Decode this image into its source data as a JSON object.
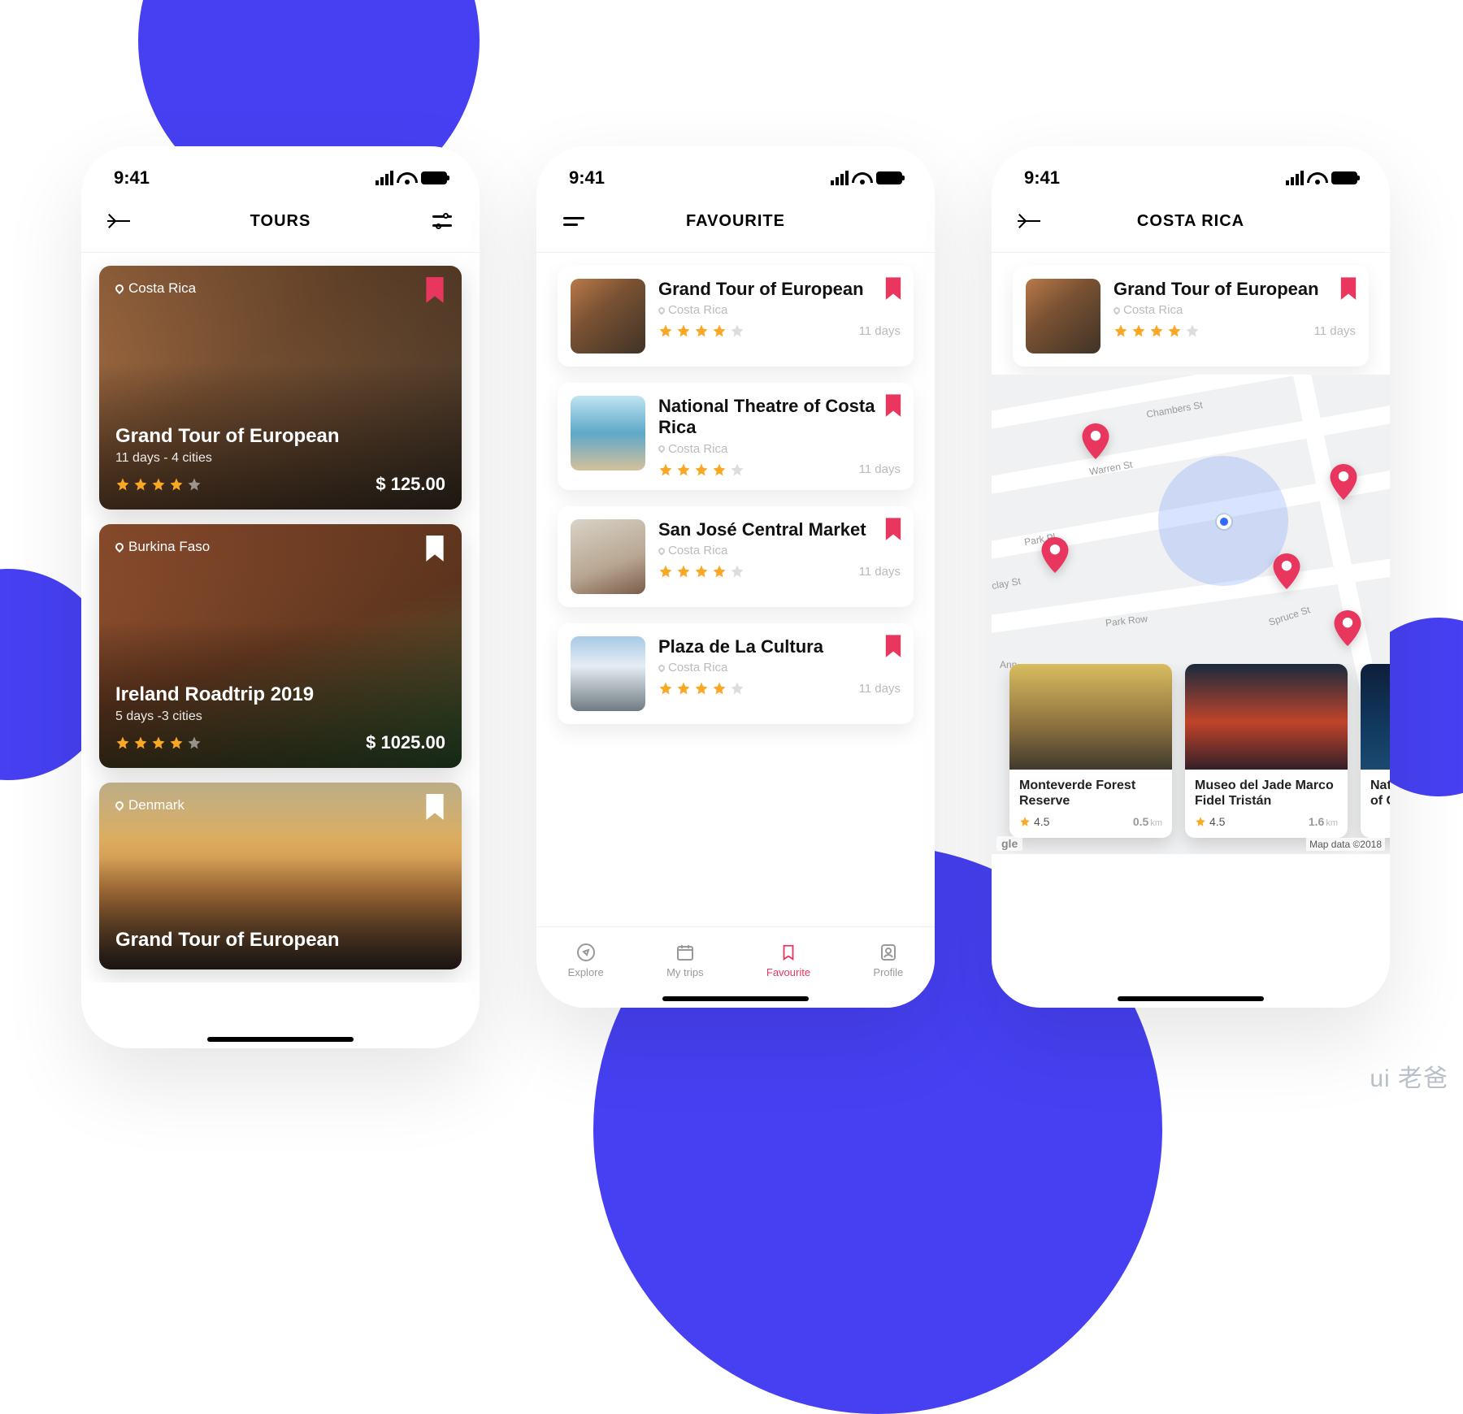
{
  "status": {
    "time": "9:41"
  },
  "brand": "ui 老爸",
  "screen1": {
    "title": "TOURS",
    "tours": [
      {
        "location": "Costa Rica",
        "title": "Grand Tour of European",
        "sub": "11 days - 4 cities",
        "price": "$ 125.00",
        "rating": 4,
        "bookmarked": true
      },
      {
        "location": "Burkina Faso",
        "title": "Ireland Roadtrip 2019",
        "sub": "5 days -3 cities",
        "price": "$ 1025.00",
        "rating": 4,
        "bookmarked": false
      },
      {
        "location": "Denmark",
        "title": "Grand Tour of European",
        "sub": "",
        "price": "",
        "rating": 0,
        "bookmarked": false
      }
    ]
  },
  "screen2": {
    "title": "FAVOURITE",
    "items": [
      {
        "title": "Grand Tour of European",
        "location": "Costa Rica",
        "days": "11 days",
        "rating": 4
      },
      {
        "title": "National Theatre of Costa Rica",
        "location": "Costa Rica",
        "days": "11 days",
        "rating": 4
      },
      {
        "title": "San José Central Market",
        "location": "Costa Rica",
        "days": "11 days",
        "rating": 4
      },
      {
        "title": "Plaza de La Cultura",
        "location": "Costa Rica",
        "days": "11 days",
        "rating": 4
      }
    ],
    "tabs": [
      {
        "label": "Explore"
      },
      {
        "label": "My trips"
      },
      {
        "label": "Favourite"
      },
      {
        "label": "Profile"
      }
    ]
  },
  "screen3": {
    "title": "COSTA RICA",
    "featured": {
      "title": "Grand Tour of European",
      "location": "Costa Rica",
      "days": "11 days",
      "rating": 4
    },
    "map": {
      "streets": [
        "Chambers St",
        "Warren St",
        "Park Pl",
        "Park Row",
        "Spruce St",
        "clay St",
        "Ann"
      ],
      "attr": "Map data ©2018",
      "logo": "gle"
    },
    "places": [
      {
        "title": "Monteverde Forest Reserve",
        "rating": "4.5",
        "dist": "0.5",
        "unit": "km"
      },
      {
        "title": "Museo del Jade Marco Fidel Tristán",
        "rating": "4.5",
        "dist": "1.6",
        "unit": "km"
      },
      {
        "title": "Nati of C",
        "rating": "",
        "dist": "",
        "unit": ""
      }
    ]
  }
}
